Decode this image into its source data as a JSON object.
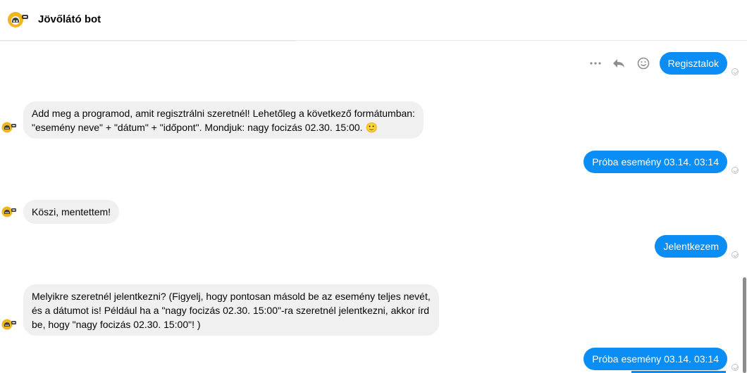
{
  "header": {
    "title": "Jövőlátó bot"
  },
  "toolbar": {
    "more_icon": "more-horizontal-icon",
    "reply_icon": "reply-icon",
    "react_icon": "smiley-icon"
  },
  "messages": [
    {
      "side": "out",
      "text": "Regisztalok"
    },
    {
      "side": "in",
      "lines": [
        "Add meg a programod, amit regisztrálni szeretnél! Lehetőleg a következő formátumban:",
        "\"esemény neve\" + \"dátum\" + \"időpont\". Mondjuk: nagy focizás 02.30. 15:00."
      ],
      "emoji": "🙂"
    },
    {
      "side": "out",
      "text": "Próba esemény 03.14. 03:14"
    },
    {
      "side": "in",
      "lines": [
        "Köszi, mentettem!"
      ]
    },
    {
      "side": "out",
      "text": "Jelentkezem"
    },
    {
      "side": "in",
      "lines": [
        "Melyikre szeretnél jelentkezni? (Figyelj, hogy pontosan másold be az esemény teljes nevét,",
        "és a dátumot is! Például ha a \"nagy focizás 02.30. 15:00\"-ra szeretnél jelentkezni, akkor írd",
        "be, hogy \"nagy focizás 02.30. 15:00\"! )"
      ]
    },
    {
      "side": "out",
      "text": "Próba esemény 03.14. 03:14"
    }
  ],
  "colors": {
    "outgoing_bubble": "#0a8df5",
    "incoming_bubble": "#f0f0f0",
    "avatar_yellow": "#f2b51b"
  }
}
